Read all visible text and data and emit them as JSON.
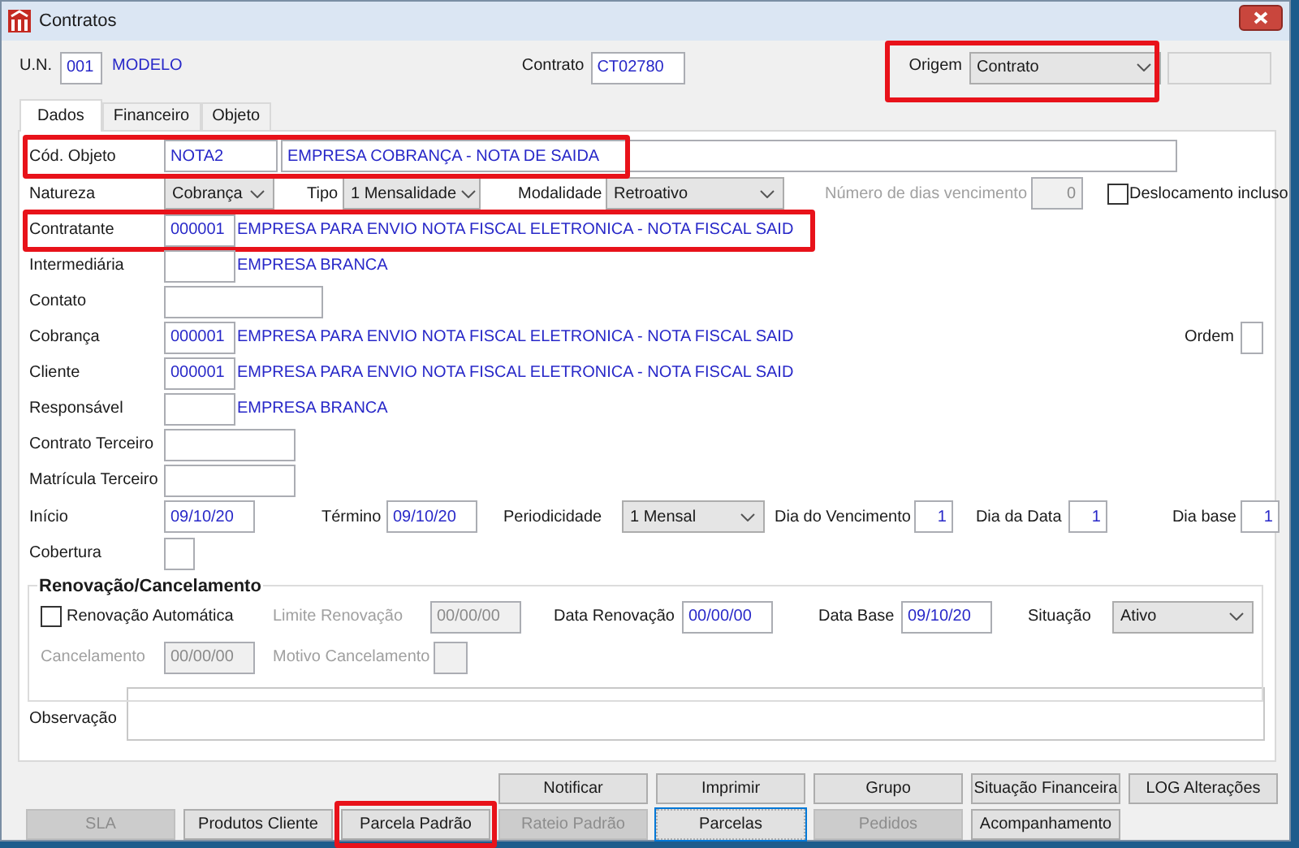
{
  "window": {
    "title": "Contratos"
  },
  "header": {
    "un_label": "U.N.",
    "un_code": "001",
    "un_name": "MODELO",
    "contrato_label": "Contrato",
    "contrato": "CT02780",
    "origem_label": "Origem",
    "origem": "Contrato",
    "origem_highlighted": true
  },
  "tabs": [
    {
      "label": "Dados",
      "selected": true
    },
    {
      "label": "Financeiro",
      "selected": false
    },
    {
      "label": "Objeto",
      "selected": false
    }
  ],
  "cod_objeto": {
    "label": "Cód. Objeto",
    "code": "NOTA2",
    "name": "EMPRESA COBRANÇA - NOTA DE SAIDA",
    "highlighted": true
  },
  "classificacao": {
    "natureza_label": "Natureza",
    "natureza": "Cobrança",
    "tipo_label": "Tipo",
    "tipo": "1 Mensalidade",
    "modalidade_label": "Modalidade",
    "modalidade": "Retroativo",
    "dias_label": "Número de dias vencimento",
    "dias": "0",
    "dias_disabled": true,
    "deslocamento_label": "Deslocamento incluso",
    "deslocamento_checked": false
  },
  "parties": [
    {
      "kind": "lookup",
      "label": "Contratante",
      "code": "000001",
      "name": "EMPRESA PARA ENVIO NOTA FISCAL ELETRONICA - NOTA FISCAL SAID",
      "highlighted": true
    },
    {
      "kind": "lookup",
      "label": "Intermediária",
      "name": "EMPRESA BRANCA",
      "highlighted": false
    },
    {
      "kind": "text",
      "label": "Contato",
      "highlighted": false
    },
    {
      "kind": "lookup",
      "label": "Cobrança",
      "code": "000001",
      "name": "EMPRESA PARA ENVIO NOTA FISCAL ELETRONICA - NOTA FISCAL SAID",
      "side_label": "Ordem",
      "highlighted": false
    },
    {
      "kind": "lookup",
      "label": "Cliente",
      "code": "000001",
      "name": "EMPRESA PARA ENVIO NOTA FISCAL ELETRONICA - NOTA FISCAL SAID",
      "highlighted": false
    },
    {
      "kind": "lookup",
      "label": "Responsável",
      "name": "EMPRESA BRANCA",
      "highlighted": false
    },
    {
      "kind": "medium",
      "label": "Contrato Terceiro",
      "highlighted": false
    },
    {
      "kind": "medium",
      "label": "Matrícula Terceiro",
      "highlighted": false
    }
  ],
  "periodo": {
    "inicio_label": "Início",
    "inicio": "09/10/20",
    "termino_label": "Término",
    "termino": "09/10/20",
    "periodicidade_label": "Periodicidade",
    "periodicidade": "1 Mensal",
    "dia_venc_label": "Dia do Vencimento",
    "dia_venc": "1",
    "dia_data_label": "Dia da Data",
    "dia_data": "1",
    "dia_base_label": "Dia base",
    "dia_base": "1"
  },
  "cobertura": {
    "label": "Cobertura"
  },
  "renovacao": {
    "title": "Renovação/Cancelamento",
    "auto_label": "Renovação Automática",
    "auto_checked": false,
    "limite_label": "Limite Renovação",
    "limite": "00/00/00",
    "data_renov_label": "Data Renovação",
    "data_renov": "00/00/00",
    "data_base_label": "Data Base",
    "data_base": "09/10/20",
    "situacao_label": "Situação",
    "situacao": "Ativo",
    "cancel_label": "Cancelamento",
    "cancel": "00/00/00",
    "motivo_label": "Motivo Cancelamento",
    "cancel_disabled": true
  },
  "observacao": {
    "label": "Observação"
  },
  "buttons_top": [
    {
      "label": "Notificar",
      "disabled": false,
      "focused": false,
      "highlighted": false
    },
    {
      "label": "Imprimir",
      "disabled": false,
      "focused": false,
      "highlighted": false
    },
    {
      "label": "Grupo",
      "disabled": false,
      "focused": false,
      "highlighted": false
    },
    {
      "label": "Situação Financeira",
      "disabled": false,
      "focused": false,
      "highlighted": false
    },
    {
      "label": "LOG Alterações",
      "disabled": false,
      "focused": false,
      "highlighted": false
    }
  ],
  "buttons_bottom": [
    {
      "label": "SLA",
      "disabled": true,
      "focused": false,
      "highlighted": false
    },
    {
      "label": "Produtos Cliente",
      "disabled": false,
      "focused": false,
      "highlighted": false
    },
    {
      "label": "Parcela Padrão",
      "disabled": false,
      "focused": false,
      "highlighted": true
    },
    {
      "label": "Rateio Padrão",
      "disabled": true,
      "focused": false,
      "highlighted": false
    },
    {
      "label": "Parcelas",
      "disabled": false,
      "focused": true,
      "highlighted": false
    },
    {
      "label": "Pedidos",
      "disabled": true,
      "focused": false,
      "highlighted": false
    },
    {
      "label": "Acompanhamento",
      "disabled": false,
      "focused": false,
      "highlighted": false
    }
  ]
}
